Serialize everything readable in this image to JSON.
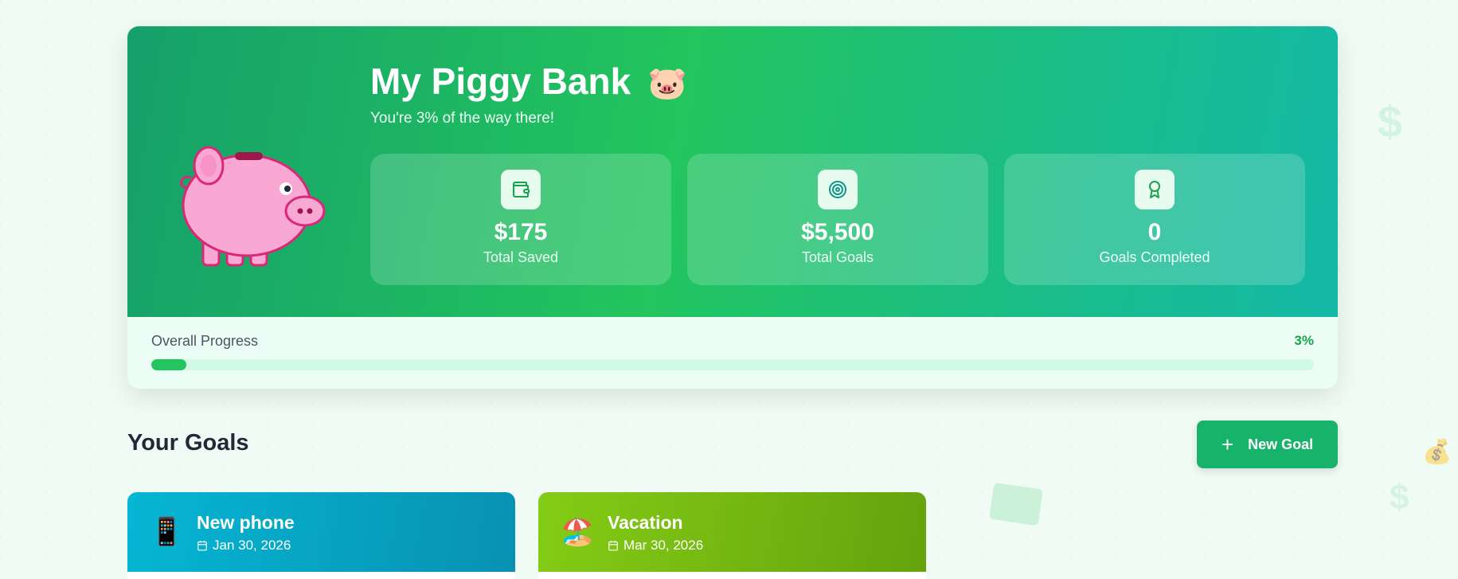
{
  "hero": {
    "title": "My Piggy Bank",
    "title_emoji": "🐷",
    "subtitle": "You're 3% of the way there!"
  },
  "stats": [
    {
      "icon": "wallet-icon",
      "value": "$175",
      "label": "Total Saved"
    },
    {
      "icon": "target-icon",
      "value": "$5,500",
      "label": "Total Goals"
    },
    {
      "icon": "award-icon",
      "value": "0",
      "label": "Goals Completed"
    }
  ],
  "progress": {
    "label": "Overall Progress",
    "value_text": "3%",
    "fraction": 0.03
  },
  "goals_section": {
    "title": "Your Goals",
    "new_goal_label": "New Goal"
  },
  "goals": [
    {
      "emoji": "📱",
      "name": "New phone",
      "date": "Jan 30, 2026",
      "color_from": "#06b6d4",
      "color_to": "#0891b2"
    },
    {
      "emoji": "🏖️",
      "name": "Vacation",
      "date": "Mar 30, 2026",
      "color_from": "#84cc16",
      "color_to": "#65a30d"
    }
  ],
  "colors": {
    "accent": "#22c55e",
    "hero_start": "#16a06a",
    "hero_end": "#14b8a6"
  }
}
